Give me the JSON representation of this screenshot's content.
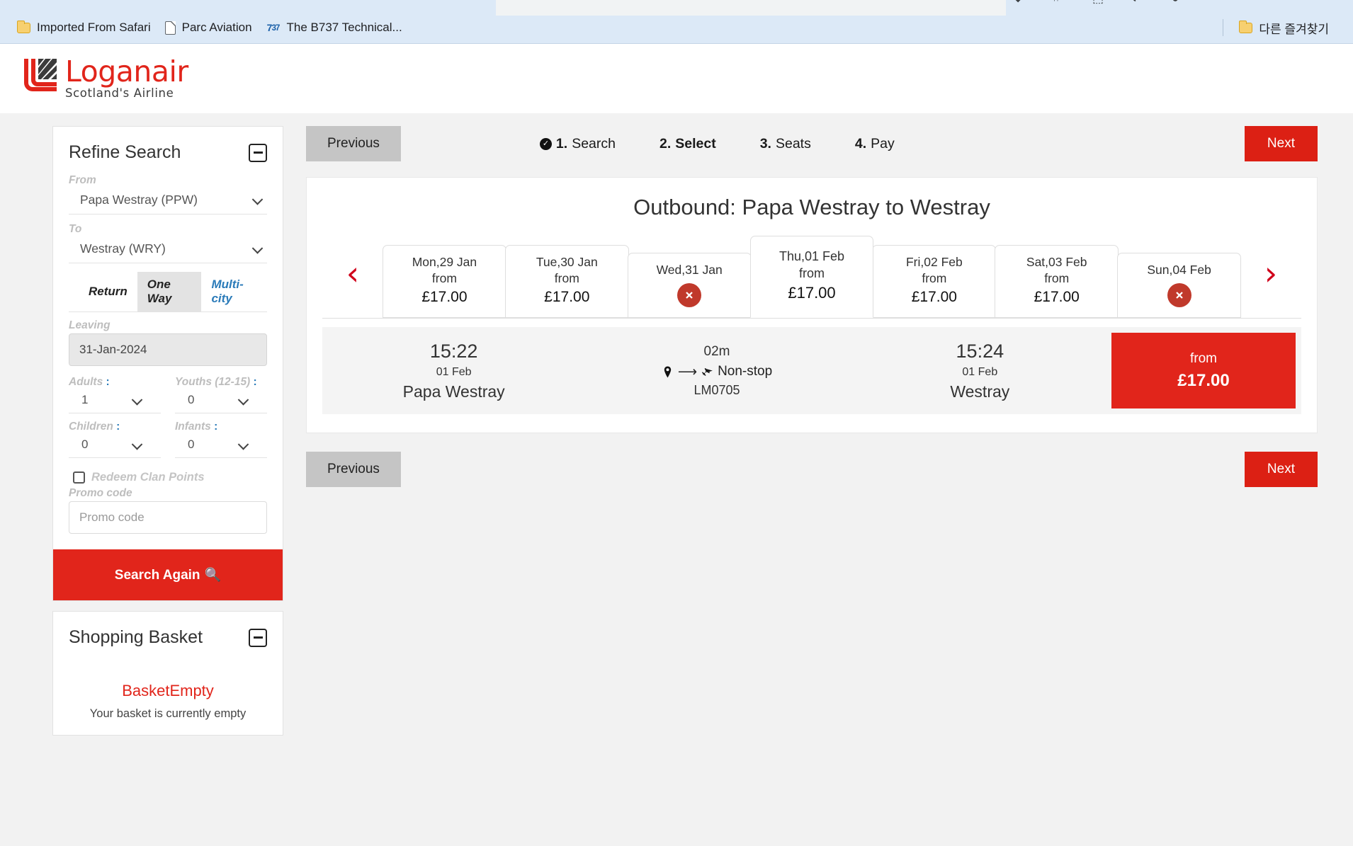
{
  "browser": {
    "bookmarks": [
      {
        "label": "Imported From Safari",
        "icon": "folder-icon"
      },
      {
        "label": "Parc Aviation",
        "icon": "page-icon"
      },
      {
        "label": "The B737 Technical...",
        "icon": "b737-icon"
      }
    ],
    "other_bookmarks": {
      "label": "다른 즐겨찾기",
      "icon": "folder-icon"
    }
  },
  "header": {
    "brand_name": "Loganair",
    "tagline": "Scotland's Airline",
    "brand_color": "#e1251b"
  },
  "sidebar": {
    "refine": {
      "title": "Refine Search",
      "from_label": "From",
      "from_value": "Papa Westray (PPW)",
      "to_label": "To",
      "to_value": "Westray (WRY)",
      "trip_tabs": [
        {
          "label": "Return",
          "selected": false
        },
        {
          "label": "One Way",
          "selected": true
        },
        {
          "label": "Multi-city",
          "selected": false
        }
      ],
      "leaving_label": "Leaving",
      "leaving_value": "31-Jan-2024",
      "adults_label": "Adults",
      "adults_value": "1",
      "youths_label": "Youths (12-15)",
      "youths_value": "0",
      "children_label": "Children",
      "children_value": "0",
      "infants_label": "Infants",
      "infants_value": "0",
      "redeem_label": "Redeem Clan Points",
      "promo_label": "Promo code",
      "promo_placeholder": "Promo code",
      "promo_value": "",
      "search_button": "Search Again"
    },
    "basket": {
      "title": "Shopping Basket",
      "empty_title": "BasketEmpty",
      "empty_text": "Your basket is currently empty"
    }
  },
  "main": {
    "previous_label": "Previous",
    "next_label": "Next",
    "steps": [
      {
        "num": "1.",
        "label": "Search",
        "done": true,
        "active": false
      },
      {
        "num": "2.",
        "label": "Select",
        "done": false,
        "active": true
      },
      {
        "num": "3.",
        "label": "Seats",
        "done": false,
        "active": false
      },
      {
        "num": "4.",
        "label": "Pay",
        "done": false,
        "active": false
      }
    ],
    "results_title": "Outbound: Papa Westray to Westray",
    "prev_arrow": "‹",
    "next_arrow": "›",
    "date_tabs": [
      {
        "day": "Mon,29 Jan",
        "from": "from",
        "price": "£17.00",
        "unavailable": false,
        "active": false
      },
      {
        "day": "Tue,30 Jan",
        "from": "from",
        "price": "£17.00",
        "unavailable": false,
        "active": false
      },
      {
        "day": "Wed,31 Jan",
        "from": "",
        "price": "",
        "unavailable": true,
        "active": false
      },
      {
        "day": "Thu,01 Feb",
        "from": "from",
        "price": "£17.00",
        "unavailable": false,
        "active": true
      },
      {
        "day": "Fri,02 Feb",
        "from": "from",
        "price": "£17.00",
        "unavailable": false,
        "active": false
      },
      {
        "day": "Sat,03 Feb",
        "from": "from",
        "price": "£17.00",
        "unavailable": false,
        "active": false
      },
      {
        "day": "Sun,04 Feb",
        "from": "",
        "price": "",
        "unavailable": true,
        "active": false
      }
    ],
    "flight": {
      "depart_time": "15:22",
      "depart_date": "01 Feb",
      "depart_place": "Papa Westray",
      "duration": "02m",
      "stops": "Non-stop",
      "flight_number": "LM0705",
      "arrive_time": "15:24",
      "arrive_date": "01 Feb",
      "arrive_place": "Westray",
      "fare_from": "from",
      "fare_price": "£17.00"
    },
    "bottom_previous_label": "Previous",
    "bottom_next_label": "Next"
  }
}
